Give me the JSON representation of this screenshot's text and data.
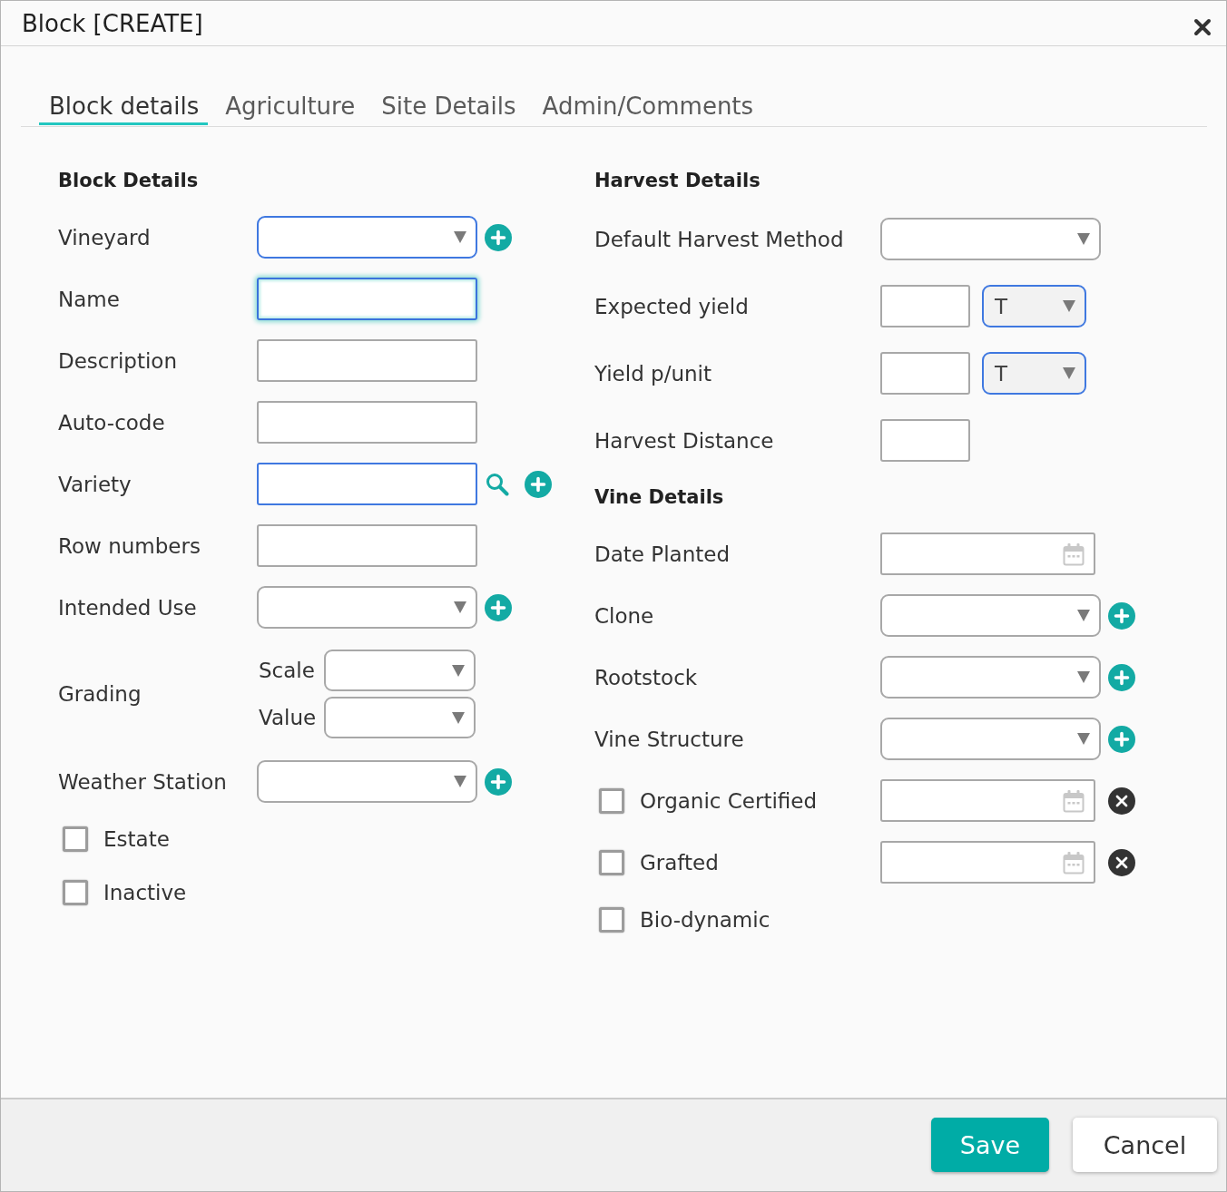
{
  "window": {
    "title": "Block [CREATE]"
  },
  "tabs": [
    {
      "label": "Block details",
      "selected": true
    },
    {
      "label": "Agriculture",
      "selected": false
    },
    {
      "label": "Site Details",
      "selected": false
    },
    {
      "label": "Admin/Comments",
      "selected": false
    }
  ],
  "columns": [
    {
      "sections": [
        {
          "title": "Block Details",
          "fields": [
            {
              "kind": "select",
              "label": "Vineyard",
              "highlighted": true,
              "focused": false,
              "add_button": true
            },
            {
              "kind": "text",
              "label": "Name",
              "highlighted": false,
              "focused": true,
              "add_button": false
            },
            {
              "kind": "text",
              "label": "Description",
              "highlighted": false,
              "focused": false,
              "add_button": false
            },
            {
              "kind": "text",
              "label": "Auto-code",
              "highlighted": false,
              "focused": false,
              "add_button": false
            },
            {
              "kind": "lookup",
              "label": "Variety",
              "highlighted": true,
              "focused": false,
              "add_button": true
            },
            {
              "kind": "text",
              "label": "Row numbers",
              "highlighted": false,
              "focused": false,
              "add_button": false
            },
            {
              "kind": "select",
              "label": "Intended Use",
              "highlighted": false,
              "focused": false,
              "add_button": true
            },
            {
              "kind": "grading",
              "label": "Grading",
              "parts": [
                {
                  "label": "Scale",
                  "highlighted": false,
                  "focused": false
                },
                {
                  "label": "Value",
                  "highlighted": false,
                  "focused": false
                }
              ]
            },
            {
              "kind": "select",
              "label": "Weather Station",
              "highlighted": false,
              "focused": false,
              "add_button": true
            },
            {
              "kind": "checkbox",
              "label": "Estate",
              "checked": false
            },
            {
              "kind": "checkbox",
              "label": "Inactive",
              "checked": false
            }
          ]
        }
      ]
    },
    {
      "sections": [
        {
          "title": "Harvest Details",
          "fields": [
            {
              "kind": "select",
              "label": "Default Harvest Method",
              "highlighted": false,
              "focused": false,
              "add_button": false
            },
            {
              "kind": "quantity",
              "label": "Expected yield",
              "highlighted": false,
              "focused": false,
              "unit": {
                "value": "T",
                "highlighted": true
              }
            },
            {
              "kind": "quantity",
              "label": "Yield p/unit",
              "highlighted": false,
              "focused": false,
              "unit": {
                "value": "T",
                "highlighted": true
              }
            },
            {
              "kind": "short_text",
              "label": "Harvest Distance",
              "highlighted": false,
              "focused": false
            }
          ]
        },
        {
          "title": "Vine Details",
          "fields": [
            {
              "kind": "date",
              "label": "Date Planted",
              "highlighted": false,
              "focused": false
            },
            {
              "kind": "select",
              "label": "Clone",
              "highlighted": false,
              "focused": false,
              "add_button": true
            },
            {
              "kind": "select",
              "label": "Rootstock",
              "highlighted": false,
              "focused": false,
              "add_button": true
            },
            {
              "kind": "select",
              "label": "Vine Structure",
              "highlighted": false,
              "focused": false,
              "add_button": true
            },
            {
              "kind": "checkbox_date",
              "label": "Organic Certified",
              "checked": false,
              "highlighted": false,
              "focused": false
            },
            {
              "kind": "checkbox_date",
              "label": "Grafted",
              "checked": false,
              "highlighted": false,
              "focused": false
            },
            {
              "kind": "checkbox",
              "label": "Bio-dynamic",
              "checked": false
            }
          ]
        }
      ]
    }
  ],
  "footer": {
    "buttons": [
      {
        "label": "Save",
        "kind": "primary"
      },
      {
        "label": "Cancel",
        "kind": "secondary"
      }
    ]
  }
}
